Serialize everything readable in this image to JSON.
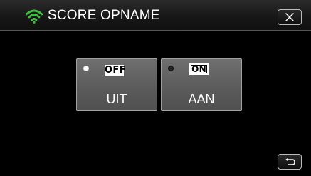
{
  "header": {
    "title": "SCORE OPNAME",
    "wifi_icon": "wifi-icon",
    "close_icon": "close-icon"
  },
  "options": [
    {
      "badge": "OFF",
      "label": "UIT",
      "selected": true
    },
    {
      "badge": "ON",
      "label": "AAN",
      "selected": false
    }
  ],
  "footer": {
    "back_icon": "return-icon"
  },
  "colors": {
    "wifi": "#3fbf3f",
    "background": "#000000",
    "button_gray": "#666666"
  }
}
